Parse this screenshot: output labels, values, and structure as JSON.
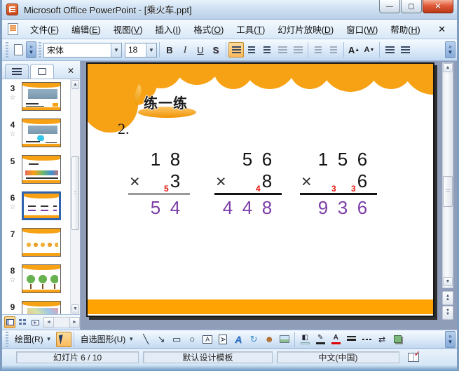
{
  "window": {
    "title": "Microsoft Office PowerPoint - [乘火车.ppt]"
  },
  "menubar": {
    "items": [
      "文件(F)",
      "编辑(E)",
      "视图(V)",
      "插入(I)",
      "格式(O)",
      "工具(T)",
      "幻灯片放映(D)",
      "窗口(W)",
      "帮助(H)"
    ],
    "close_label": "✕"
  },
  "toolbar": {
    "font_name": "宋体",
    "font_size": "18",
    "bold": "B",
    "italic": "I",
    "underline": "U",
    "shadow": "S",
    "grow_font": "A",
    "shrink_font": "A"
  },
  "sidebar": {
    "slides": [
      {
        "num": "3",
        "star": true,
        "selected": false,
        "kind": "train"
      },
      {
        "num": "4",
        "star": true,
        "selected": false,
        "kind": "train2"
      },
      {
        "num": "5",
        "star": false,
        "selected": false,
        "kind": "crowd"
      },
      {
        "num": "6",
        "star": true,
        "selected": true,
        "kind": "math"
      },
      {
        "num": "7",
        "star": false,
        "selected": false,
        "kind": "ducks"
      },
      {
        "num": "8",
        "star": true,
        "selected": false,
        "kind": "trees"
      },
      {
        "num": "9",
        "star": false,
        "selected": false,
        "kind": "photo"
      }
    ]
  },
  "slide": {
    "badge": "练一练",
    "item_number": "2.",
    "op": "×",
    "colors": {
      "orange": "#F7A114",
      "result": "#7C3FA8",
      "carry": "#E8150D"
    },
    "problems": [
      {
        "multiplicand": "18",
        "multiplier": "3",
        "product": "54",
        "carries": [
          {
            "col": 1,
            "digit": "5"
          }
        ],
        "line_color": "#9A9A9A"
      },
      {
        "multiplicand": "56",
        "multiplier": "8",
        "product": "448",
        "carries": [
          {
            "col": 1,
            "digit": "4"
          }
        ],
        "line_color": "#151515"
      },
      {
        "multiplicand": "156",
        "multiplier": "6",
        "product": "936",
        "carries": [
          {
            "col": 1,
            "digit": "3"
          },
          {
            "col": 2,
            "digit": "3"
          }
        ],
        "line_color": "#151515"
      }
    ]
  },
  "drawing": {
    "draw_label": "绘图(R)",
    "autoshapes_label": "自选图形(U)"
  },
  "statusbar": {
    "slide_info": "幻灯片 6 / 10",
    "template_name": "默认设计模板",
    "language": "中文(中国)"
  }
}
